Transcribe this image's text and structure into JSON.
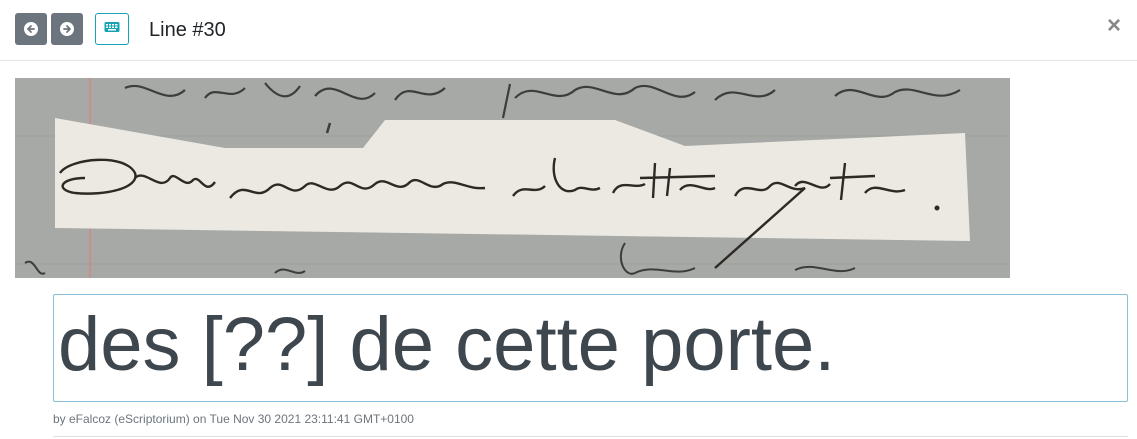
{
  "header": {
    "title": "Line #30",
    "prev_icon": "arrow-left-circle-icon",
    "next_icon": "arrow-right-circle-icon",
    "keyboard_icon": "keyboard-icon",
    "close_label": "×"
  },
  "line_image": {
    "description_icon": "manuscript-line-image"
  },
  "editor": {
    "transcription": "des [??] de cette porte."
  },
  "meta": {
    "version_info": "by eFalcoz (eScriptorium) on Tue Nov 30 2021 23:11:41 GMT+0100"
  },
  "colors": {
    "nav_button_bg": "#6c757d",
    "keyboard_border": "#17a2b8",
    "editor_border": "#8bbfd7"
  }
}
